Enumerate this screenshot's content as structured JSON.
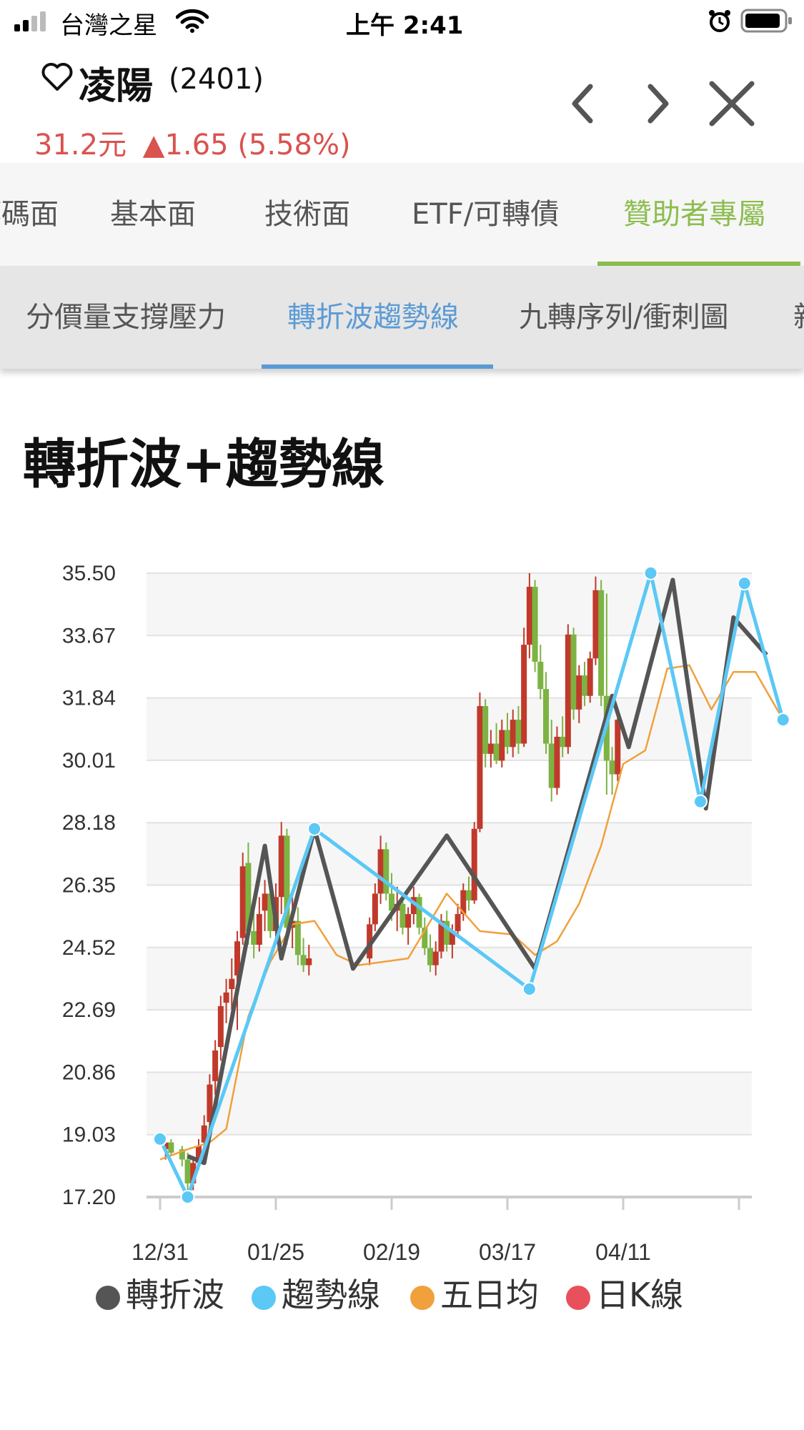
{
  "status_bar": {
    "carrier": "台灣之星",
    "time": "上午 2:41"
  },
  "header": {
    "stock_name": "凌陽",
    "stock_code": "(2401)",
    "price": "31.2元",
    "change": "▲1.65 (5.58%)"
  },
  "main_tabs": [
    {
      "label": "籌碼面"
    },
    {
      "label": "基本面"
    },
    {
      "label": "技術面"
    },
    {
      "label": "ETF/可轉債"
    },
    {
      "label": "贊助者專屬"
    }
  ],
  "sub_tabs": [
    {
      "label": "分價量支撐壓力"
    },
    {
      "label": "轉折波趨勢線"
    },
    {
      "label": "九轉序列/衝刺圖"
    },
    {
      "label": "新"
    }
  ],
  "section_title": "轉折波+趨勢線",
  "colors": {
    "up": "#d9534f",
    "accent_green": "#8cbd4f",
    "accent_blue": "#5b9bd5",
    "zigzag": "#555555",
    "trend": "#5bc8f5",
    "ma5": "#f0a03c",
    "k_red": "#c0392b",
    "k_green": "#7cb342"
  },
  "chart_data": {
    "type": "line",
    "y_ticks": [
      "35.50",
      "33.67",
      "31.84",
      "30.01",
      "28.18",
      "26.35",
      "24.52",
      "22.69",
      "20.86",
      "19.03",
      "17.20"
    ],
    "ylim": [
      17.2,
      35.5
    ],
    "x_ticks": [
      "12/31",
      "01/25",
      "02/19",
      "03/17",
      "04/11"
    ],
    "x_range_days": [
      0,
      105
    ],
    "legend": [
      "轉折波",
      "趨勢線",
      "五日均",
      "日K線"
    ],
    "series": [
      {
        "name": "轉折波",
        "points": [
          [
            5,
            18.4
          ],
          [
            8,
            18.2
          ],
          [
            19,
            27.5
          ],
          [
            22,
            24.2
          ],
          [
            28,
            28.0
          ],
          [
            35,
            23.9
          ],
          [
            52,
            27.8
          ],
          [
            68,
            23.9
          ],
          [
            82,
            31.9
          ],
          [
            85,
            30.4
          ],
          [
            93,
            35.3
          ],
          [
            99,
            28.6
          ],
          [
            104,
            34.2
          ],
          [
            110,
            33.1
          ]
        ]
      },
      {
        "name": "趨勢線",
        "points": [
          [
            0,
            18.9
          ],
          [
            5,
            17.2
          ],
          [
            28,
            28.0
          ],
          [
            67,
            23.3
          ],
          [
            89,
            35.5
          ],
          [
            98,
            28.8
          ],
          [
            106,
            35.2
          ],
          [
            113,
            31.2
          ]
        ]
      },
      {
        "name": "五日均",
        "points": [
          [
            0,
            18.3
          ],
          [
            5,
            18.6
          ],
          [
            9,
            18.8
          ],
          [
            12,
            19.2
          ],
          [
            16,
            22.5
          ],
          [
            20,
            24.1
          ],
          [
            24,
            25.2
          ],
          [
            28,
            25.3
          ],
          [
            32,
            24.3
          ],
          [
            36,
            24.0
          ],
          [
            45,
            24.2
          ],
          [
            52,
            26.1
          ],
          [
            58,
            25.0
          ],
          [
            64,
            24.9
          ],
          [
            68,
            24.3
          ],
          [
            72,
            24.7
          ],
          [
            76,
            25.8
          ],
          [
            80,
            27.5
          ],
          [
            84,
            29.9
          ],
          [
            88,
            30.3
          ],
          [
            92,
            32.7
          ],
          [
            96,
            32.8
          ],
          [
            100,
            31.5
          ],
          [
            104,
            32.6
          ],
          [
            108,
            32.6
          ],
          [
            113,
            31.2
          ]
        ]
      },
      {
        "name": "日K線",
        "candles": [
          [
            1,
            18.6,
            19.0,
            18.3,
            18.8
          ],
          [
            2,
            18.8,
            18.9,
            18.4,
            18.5
          ],
          [
            4,
            18.6,
            18.7,
            18.1,
            18.3
          ],
          [
            5,
            18.3,
            18.5,
            17.3,
            17.6
          ],
          [
            6,
            17.6,
            18.4,
            17.4,
            18.2
          ],
          [
            7,
            18.2,
            18.9,
            18.0,
            18.7
          ],
          [
            8,
            18.8,
            19.6,
            18.6,
            19.3
          ],
          [
            9,
            19.4,
            20.8,
            19.2,
            20.5
          ],
          [
            10,
            20.6,
            21.8,
            20.2,
            21.5
          ],
          [
            11,
            21.6,
            23.1,
            21.2,
            22.8
          ],
          [
            12,
            22.9,
            23.6,
            22.3,
            23.2
          ],
          [
            13,
            23.3,
            24.2,
            22.7,
            23.6
          ],
          [
            14,
            23.7,
            25.0,
            22.1,
            24.7
          ],
          [
            15,
            24.8,
            27.3,
            24.6,
            26.9
          ],
          [
            16,
            27.0,
            27.6,
            24.6,
            25.0
          ],
          [
            17,
            25.0,
            25.8,
            24.2,
            24.6
          ],
          [
            18,
            24.6,
            26.0,
            24.4,
            25.5
          ],
          [
            19,
            25.6,
            26.5,
            25.0,
            26.1
          ],
          [
            20,
            26.1,
            26.4,
            24.8,
            25.0
          ],
          [
            21,
            25.0,
            26.4,
            24.6,
            26.0
          ],
          [
            22,
            26.0,
            28.2,
            25.5,
            27.8
          ],
          [
            23,
            27.8,
            28.0,
            24.6,
            25.1
          ],
          [
            24,
            25.1,
            26.0,
            24.5,
            25.3
          ],
          [
            25,
            25.3,
            25.7,
            24.0,
            24.3
          ],
          [
            26,
            24.3,
            24.8,
            23.8,
            24.0
          ],
          [
            27,
            24.0,
            24.6,
            23.7,
            24.2
          ],
          [
            38,
            24.2,
            25.4,
            24.0,
            25.2
          ],
          [
            39,
            25.2,
            26.4,
            25.0,
            26.1
          ],
          [
            40,
            26.1,
            27.8,
            25.8,
            27.4
          ],
          [
            41,
            27.4,
            27.6,
            25.9,
            26.1
          ],
          [
            42,
            26.1,
            26.7,
            25.3,
            25.6
          ],
          [
            43,
            25.6,
            26.3,
            25.0,
            25.8
          ],
          [
            44,
            25.8,
            25.9,
            24.9,
            25.1
          ],
          [
            45,
            25.1,
            25.7,
            24.6,
            25.5
          ],
          [
            46,
            25.5,
            26.3,
            25.2,
            26.0
          ],
          [
            47,
            26.0,
            26.1,
            24.9,
            25.1
          ],
          [
            48,
            25.1,
            25.4,
            24.3,
            24.5
          ],
          [
            49,
            24.5,
            24.9,
            23.8,
            24.0
          ],
          [
            50,
            24.0,
            24.7,
            23.7,
            24.4
          ],
          [
            51,
            24.4,
            25.5,
            24.2,
            25.3
          ],
          [
            52,
            25.3,
            25.6,
            24.4,
            24.6
          ],
          [
            53,
            24.6,
            25.2,
            24.2,
            25.0
          ],
          [
            54,
            25.0,
            25.8,
            24.8,
            25.5
          ],
          [
            55,
            25.5,
            26.4,
            25.3,
            26.2
          ],
          [
            56,
            26.2,
            26.6,
            25.6,
            25.9
          ],
          [
            57,
            25.9,
            28.2,
            25.8,
            28.0
          ],
          [
            58,
            28.0,
            32.0,
            27.9,
            31.6
          ],
          [
            59,
            31.6,
            31.8,
            29.8,
            30.2
          ],
          [
            60,
            30.2,
            30.9,
            29.8,
            30.5
          ],
          [
            61,
            30.5,
            31.1,
            29.9,
            30.0
          ],
          [
            62,
            30.0,
            31.2,
            29.8,
            30.9
          ],
          [
            63,
            30.9,
            31.4,
            30.2,
            30.4
          ],
          [
            64,
            30.4,
            31.5,
            30.1,
            31.2
          ],
          [
            65,
            31.2,
            31.6,
            30.2,
            30.5
          ],
          [
            66,
            30.5,
            33.9,
            30.4,
            33.4
          ],
          [
            67,
            33.4,
            35.5,
            33.0,
            35.1
          ],
          [
            68,
            35.1,
            35.3,
            32.6,
            32.9
          ],
          [
            69,
            32.9,
            33.4,
            31.8,
            32.1
          ],
          [
            70,
            32.1,
            32.6,
            30.2,
            30.5
          ],
          [
            71,
            30.5,
            31.2,
            28.8,
            29.2
          ],
          [
            72,
            29.2,
            31.0,
            29.0,
            30.7
          ],
          [
            73,
            30.7,
            31.3,
            30.1,
            30.4
          ],
          [
            74,
            30.4,
            34.0,
            30.2,
            33.7
          ],
          [
            75,
            33.7,
            33.9,
            31.2,
            31.5
          ],
          [
            76,
            31.5,
            32.8,
            31.1,
            32.5
          ],
          [
            77,
            32.5,
            32.9,
            31.6,
            31.9
          ],
          [
            78,
            31.9,
            33.2,
            31.7,
            33.0
          ],
          [
            79,
            33.0,
            35.4,
            32.8,
            35.0
          ],
          [
            80,
            35.0,
            35.3,
            31.6,
            31.9
          ],
          [
            81,
            31.9,
            34.9,
            29.0,
            30.0
          ],
          [
            82,
            30.0,
            30.4,
            29.0,
            29.6
          ],
          [
            83,
            29.6,
            31.4,
            29.4,
            31.2
          ]
        ]
      }
    ]
  }
}
